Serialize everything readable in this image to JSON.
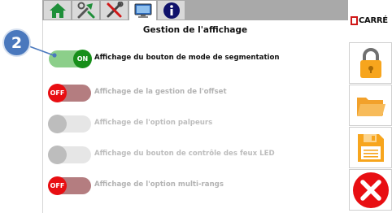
{
  "tabs": [
    {
      "name": "home",
      "icon": "home-icon"
    },
    {
      "name": "tools",
      "icon": "tools-icon"
    },
    {
      "name": "settings",
      "icon": "wrench-screwdriver-icon"
    },
    {
      "name": "display",
      "icon": "monitor-icon",
      "active": true
    },
    {
      "name": "info",
      "icon": "info-icon"
    }
  ],
  "logo": {
    "text": "CARRÉ"
  },
  "badge": {
    "number": "2"
  },
  "page": {
    "title": "Gestion de l'affichage"
  },
  "options": [
    {
      "label": "Affichage du bouton de mode de segmentation",
      "state": "ON",
      "enabled": true
    },
    {
      "label": "Affichage de la gestion de l'offset",
      "state": "OFF",
      "enabled": true
    },
    {
      "label": "Affichage de l'option palpeurs",
      "state": "",
      "enabled": false
    },
    {
      "label": "Affichage du bouton de contrôle des feux LED",
      "state": "",
      "enabled": false
    },
    {
      "label": "Affichage de l'option multi-rangs",
      "state": "OFF",
      "enabled": true
    }
  ],
  "side_buttons": [
    {
      "name": "lock",
      "icon": "padlock-icon"
    },
    {
      "name": "open",
      "icon": "folder-icon"
    },
    {
      "name": "save",
      "icon": "floppy-disk-icon"
    },
    {
      "name": "close",
      "icon": "close-icon"
    }
  ],
  "colors": {
    "on": "#178f1a",
    "off": "#e80e12",
    "badge": "#4a78bd",
    "accent": "#f7a51d"
  }
}
